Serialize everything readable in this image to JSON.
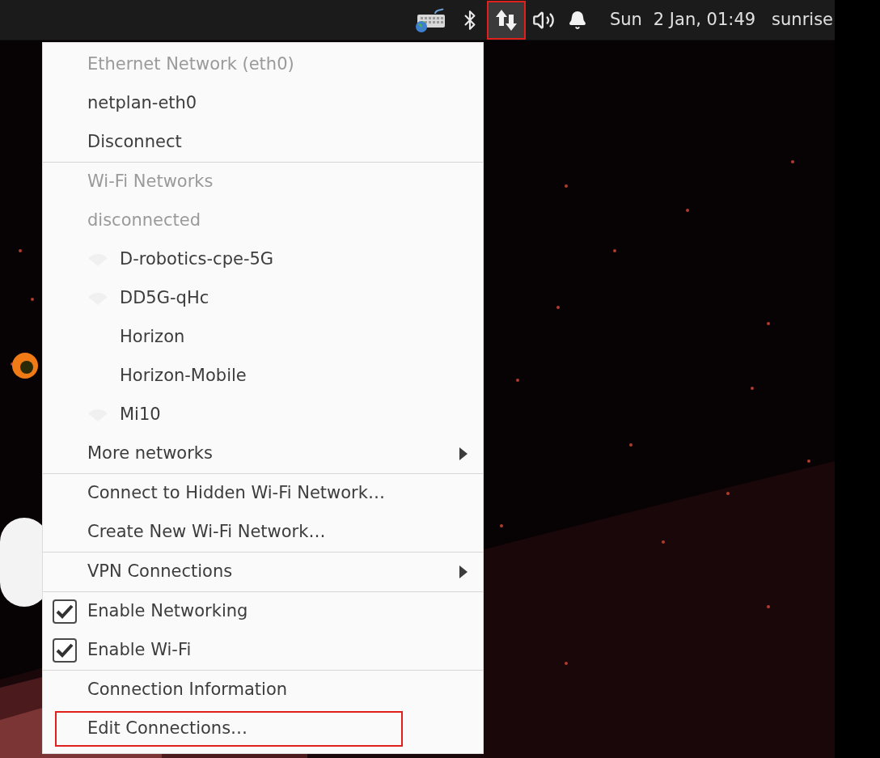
{
  "top_bar": {
    "tray_icons": [
      {
        "kind": "keyboard",
        "highlighted": false
      },
      {
        "kind": "bluetooth",
        "highlighted": false
      },
      {
        "kind": "network",
        "highlighted": true
      },
      {
        "kind": "volume",
        "highlighted": false
      },
      {
        "kind": "bell",
        "highlighted": false
      }
    ],
    "day": "Sun",
    "date_time": "2 Jan, 01:49",
    "user": "sunrise"
  },
  "menu": {
    "sections": [
      {
        "items": [
          {
            "kind": "header",
            "label": "Ethernet Network (eth0)"
          },
          {
            "kind": "item",
            "label": "netplan-eth0"
          },
          {
            "kind": "item",
            "label": "Disconnect"
          }
        ]
      },
      {
        "items": [
          {
            "kind": "header",
            "label": "Wi-Fi Networks"
          },
          {
            "kind": "header",
            "label": "disconnected"
          },
          {
            "kind": "network",
            "label": "D-robotics-cpe-5G",
            "signal_icon": true
          },
          {
            "kind": "network",
            "label": "DD5G-qHc",
            "signal_icon": true
          },
          {
            "kind": "network",
            "label": "Horizon",
            "signal_icon": false
          },
          {
            "kind": "network",
            "label": "Horizon-Mobile",
            "signal_icon": false
          },
          {
            "kind": "network",
            "label": "Mi10",
            "signal_icon": true
          },
          {
            "kind": "submenu",
            "label": "More networks"
          }
        ]
      },
      {
        "items": [
          {
            "kind": "item",
            "label": "Connect to Hidden Wi-Fi Network…"
          },
          {
            "kind": "item",
            "label": "Create New Wi-Fi Network…"
          }
        ]
      },
      {
        "items": [
          {
            "kind": "submenu",
            "label": "VPN Connections"
          }
        ]
      },
      {
        "items": [
          {
            "kind": "check",
            "label": "Enable Networking",
            "checked": true
          },
          {
            "kind": "check",
            "label": "Enable Wi-Fi",
            "checked": true
          }
        ]
      },
      {
        "items": [
          {
            "kind": "item",
            "label": "Connection Information"
          },
          {
            "kind": "item",
            "label": "Edit Connections…",
            "highlighted": true
          }
        ]
      }
    ]
  }
}
